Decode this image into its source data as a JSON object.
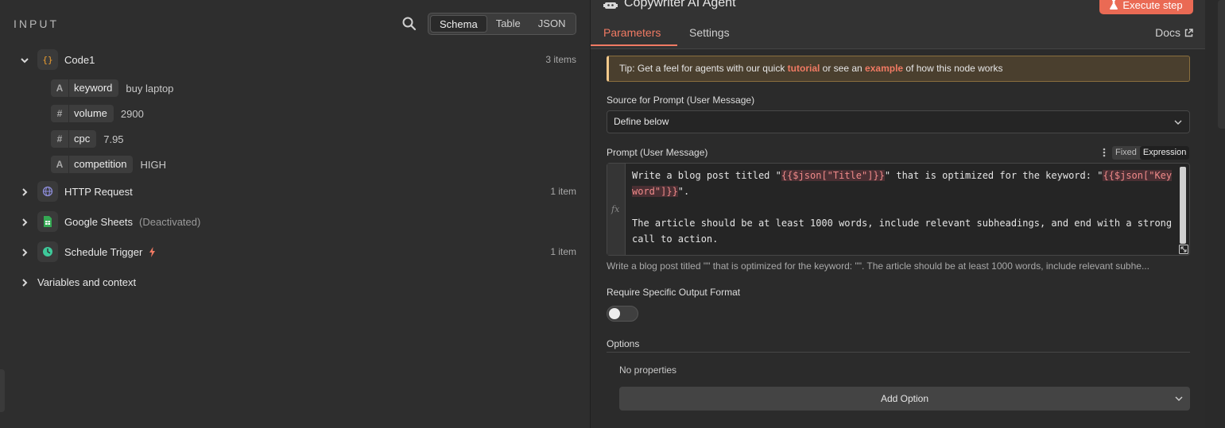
{
  "input": {
    "title": "INPUT",
    "view_tabs": [
      "Schema",
      "Table",
      "JSON"
    ],
    "active_view": "Schema",
    "nodes": [
      {
        "name": "Code1",
        "count": "3 items",
        "expanded": true,
        "fields": [
          {
            "type": "A",
            "key": "keyword",
            "value": "buy laptop"
          },
          {
            "type": "#",
            "key": "volume",
            "value": "2900"
          },
          {
            "type": "#",
            "key": "cpc",
            "value": "7.95"
          },
          {
            "type": "A",
            "key": "competition",
            "value": "HIGH"
          }
        ]
      },
      {
        "name": "HTTP Request",
        "count": "1 item"
      },
      {
        "name": "Google Sheets",
        "status": "(Deactivated)"
      },
      {
        "name": "Schedule Trigger",
        "count": "1 item"
      }
    ],
    "variables_label": "Variables and context"
  },
  "panel": {
    "title": "Copywriter AI Agent",
    "execute_label": "Execute step",
    "tabs": {
      "parameters": "Parameters",
      "settings": "Settings"
    },
    "docs_label": "Docs",
    "tip": {
      "prefix": "Tip: Get a feel for agents with our quick ",
      "link1": "tutorial",
      "middle": " or see an ",
      "link2": "example",
      "suffix": " of how this node works"
    },
    "source_label": "Source for Prompt (User Message)",
    "source_value": "Define below",
    "prompt_label": "Prompt (User Message)",
    "mode_fixed": "Fixed",
    "mode_expression": "Expression",
    "prompt": {
      "t1": "Write a blog post titled \"",
      "tok1": "{{$json[\"Title\"]}}",
      "t2": "\" that is optimized for the keyword: \"",
      "tok2": "{{$json[\"Keyword\"]}}",
      "t3": "\".",
      "t4": "The article should be at least 1000 words, include relevant subheadings, and end with a strong call to action."
    },
    "preview": "Write a blog post titled \"\" that is optimized for the keyword: \"\". The article should be at least 1000 words, include relevant subhe...",
    "output_format_label": "Require Specific Output Format",
    "options_label": "Options",
    "no_properties": "No properties",
    "add_option_label": "Add Option"
  },
  "colors": {
    "accent": "#f07a63",
    "execute": "#ea6a54",
    "code_icon": "#f0a030",
    "http_icon": "#8b8bd6",
    "sheets_icon": "#34a853",
    "trigger_icon": "#3ec99a"
  }
}
